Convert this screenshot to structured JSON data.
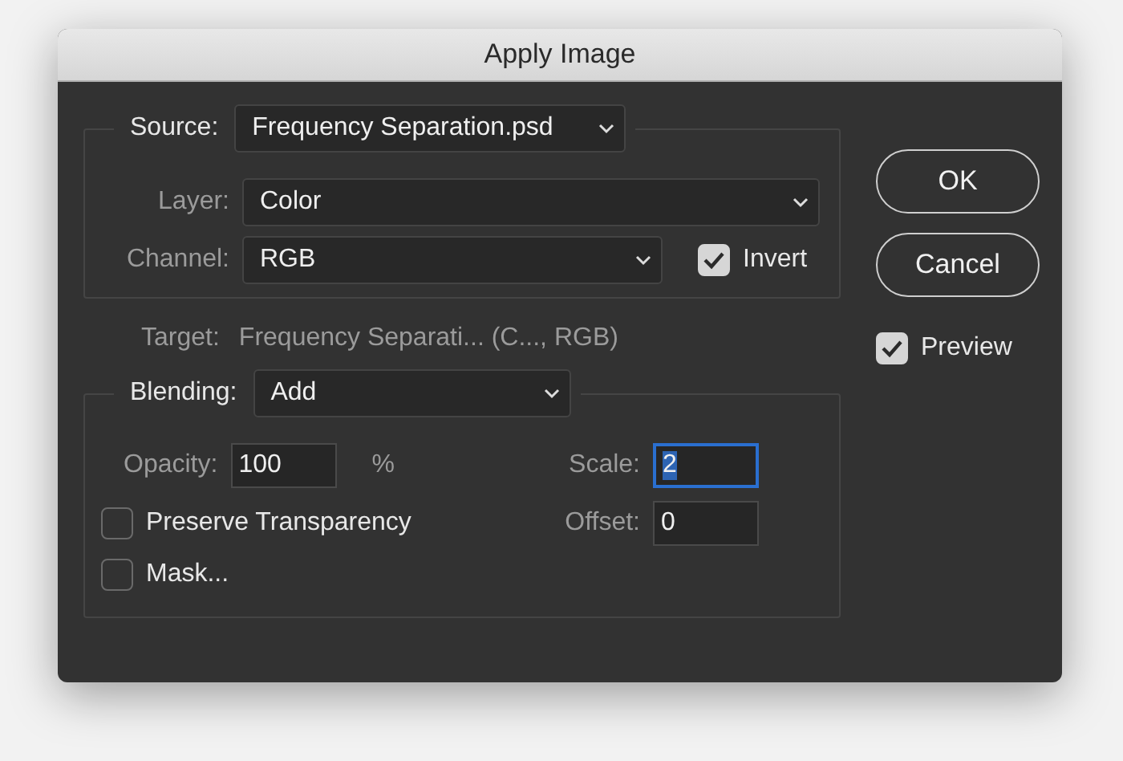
{
  "window": {
    "title": "Apply Image"
  },
  "source": {
    "label": "Source:",
    "value": "Frequency Separation.psd"
  },
  "layer": {
    "label": "Layer:",
    "value": "Color"
  },
  "channel": {
    "label": "Channel:",
    "value": "RGB"
  },
  "invert": {
    "label": "Invert",
    "checked": true
  },
  "target": {
    "label": "Target:",
    "value": "Frequency Separati... (C..., RGB)"
  },
  "blending": {
    "label": "Blending:",
    "value": "Add"
  },
  "opacity": {
    "label": "Opacity:",
    "value": "100",
    "unit": "%"
  },
  "scale": {
    "label": "Scale:",
    "value": "2",
    "focused": true
  },
  "offset": {
    "label": "Offset:",
    "value": "0",
    "focused": false
  },
  "checkboxes": [
    {
      "label": "Preserve Transparency",
      "checked": false
    },
    {
      "label": "Mask...",
      "checked": false
    }
  ],
  "buttons": [
    {
      "label": "OK"
    },
    {
      "label": "Cancel"
    }
  ],
  "preview": {
    "label": "Preview",
    "checked": true
  }
}
